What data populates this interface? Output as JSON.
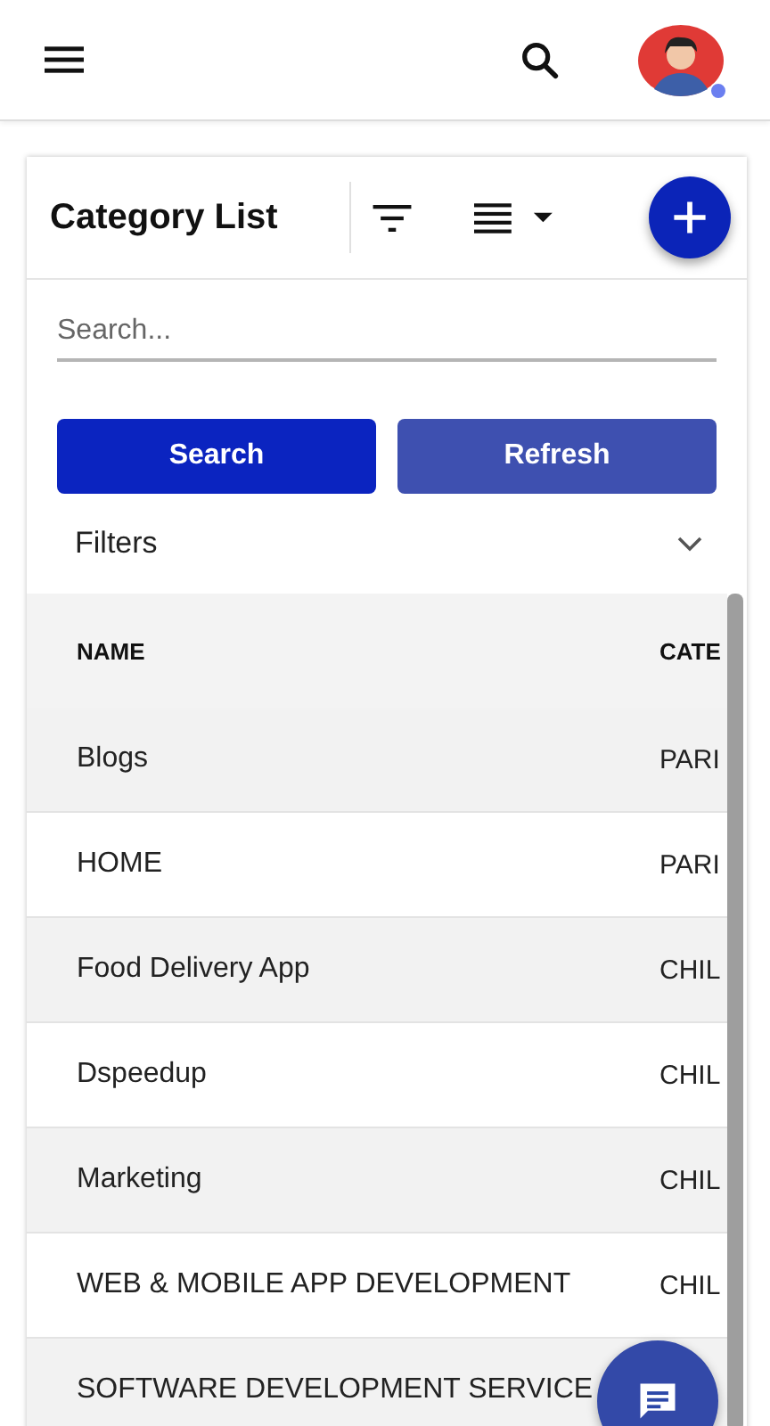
{
  "header": {
    "avatar": {
      "online": true
    }
  },
  "card": {
    "title": "Category List",
    "search": {
      "placeholder": "Search..."
    },
    "buttons": [
      {
        "label": "Search",
        "kind": "primary"
      },
      {
        "label": "Refresh",
        "kind": "secondary"
      }
    ],
    "filters": {
      "label": "Filters",
      "expanded": false
    },
    "table": {
      "columns": [
        "NAME",
        "CATE"
      ],
      "rows": [
        {
          "name": "Blogs",
          "category": "PARI"
        },
        {
          "name": "HOME",
          "category": "PARI"
        },
        {
          "name": "Food Delivery App",
          "category": "CHIL"
        },
        {
          "name": "Dspeedup",
          "category": "CHIL"
        },
        {
          "name": "Marketing",
          "category": "CHIL"
        },
        {
          "name": "WEB & MOBILE APP DEVELOPMENT",
          "category": "CHIL"
        },
        {
          "name": "SOFTWARE DEVELOPMENT SERVICE"
        }
      ]
    }
  }
}
